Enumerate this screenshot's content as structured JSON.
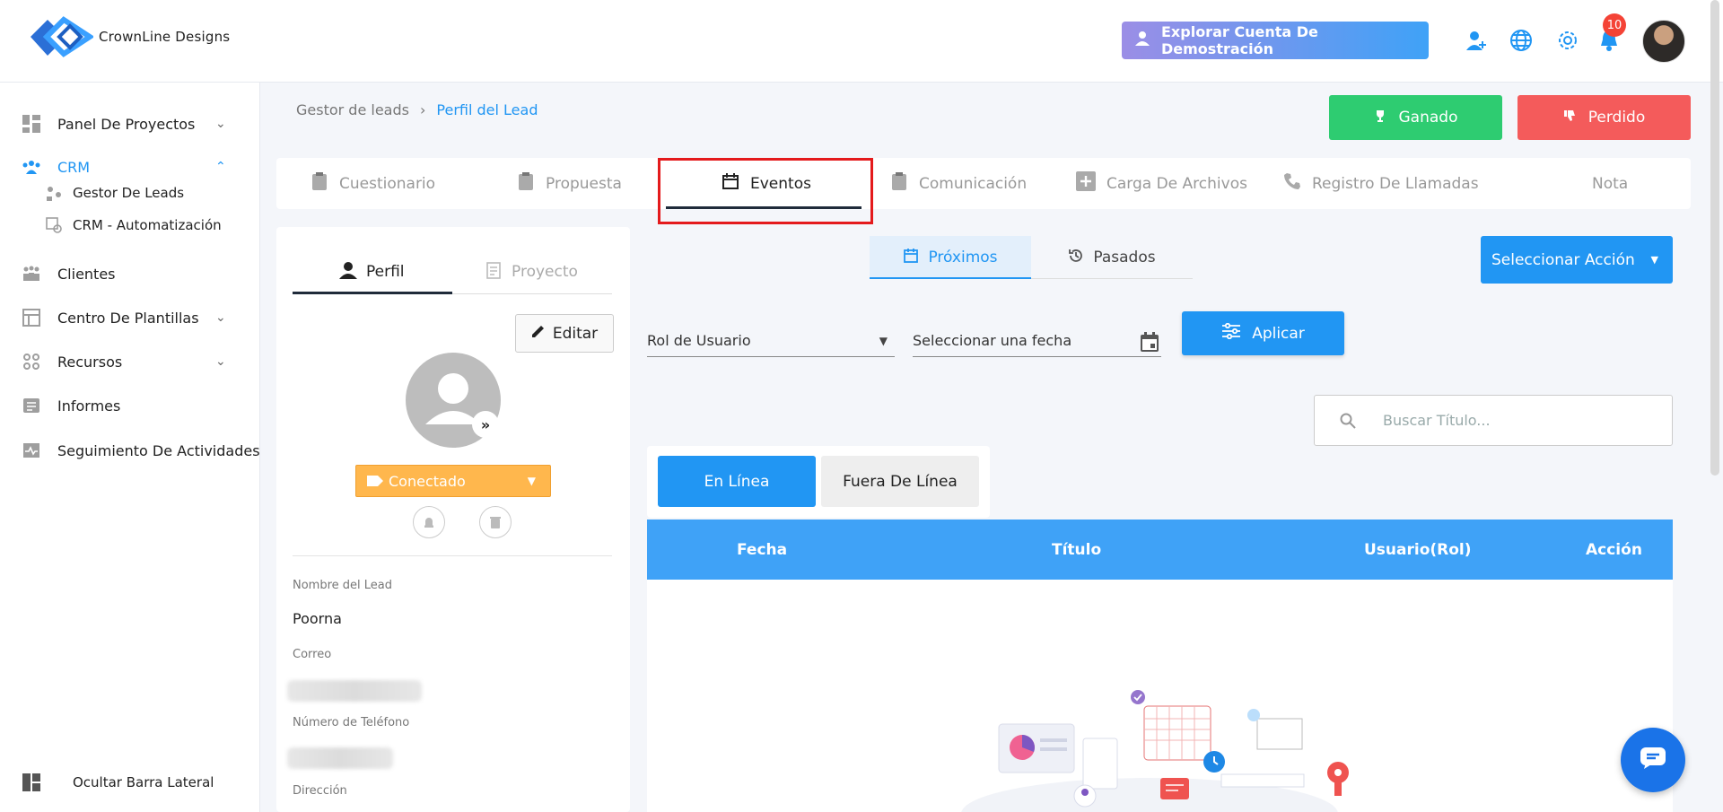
{
  "brand": {
    "name": "CrownLine Designs"
  },
  "header": {
    "demo_button": "Explorar Cuenta De Demostración",
    "notifications_count": "10"
  },
  "sidebar": {
    "items": [
      {
        "label": "Panel De Proyectos"
      },
      {
        "label": "CRM"
      },
      {
        "label": "Gestor De Leads"
      },
      {
        "label": "CRM - Automatización"
      },
      {
        "label": "Clientes"
      },
      {
        "label": "Centro De Plantillas"
      },
      {
        "label": "Recursos"
      },
      {
        "label": "Informes"
      },
      {
        "label": "Seguimiento De Actividades"
      }
    ],
    "hide_label": "Ocultar Barra Lateral"
  },
  "breadcrumb": {
    "parent": "Gestor de leads",
    "current": "Perfil del Lead"
  },
  "actions": {
    "won": "Ganado",
    "lost": "Perdido"
  },
  "tabs": [
    {
      "label": "Cuestionario"
    },
    {
      "label": "Propuesta"
    },
    {
      "label": "Eventos"
    },
    {
      "label": "Comunicación"
    },
    {
      "label": "Carga De Archivos"
    },
    {
      "label": "Registro De Llamadas"
    },
    {
      "label": "Nota"
    }
  ],
  "profile": {
    "tabs": {
      "profile": "Perfil",
      "project": "Proyecto"
    },
    "edit_button": "Editar",
    "status": "Conectado",
    "fields": {
      "lead_name_label": "Nombre del Lead",
      "lead_name_value": "Poorna",
      "email_label": "Correo",
      "phone_label": "Número de Teléfono",
      "address_label": "Dirección"
    }
  },
  "events": {
    "subtabs": {
      "upcoming": "Próximos",
      "past": "Pasados"
    },
    "select_action": "Seleccionar Acción",
    "filters": {
      "role_placeholder": "Rol de Usuario",
      "date_placeholder": "Seleccionar una fecha",
      "apply_button": "Aplicar"
    },
    "search_placeholder": "Buscar Título...",
    "mode_toggle": {
      "online": "En Línea",
      "offline": "Fuera De Línea"
    },
    "table_headers": [
      "Fecha",
      "Título",
      "Usuario(Rol)",
      "Acción"
    ]
  },
  "colors": {
    "accent": "#2196f3",
    "won": "#2ecc71",
    "lost": "#f45b5b",
    "status": "#ffb74d",
    "highlight": "#e41a1c"
  }
}
